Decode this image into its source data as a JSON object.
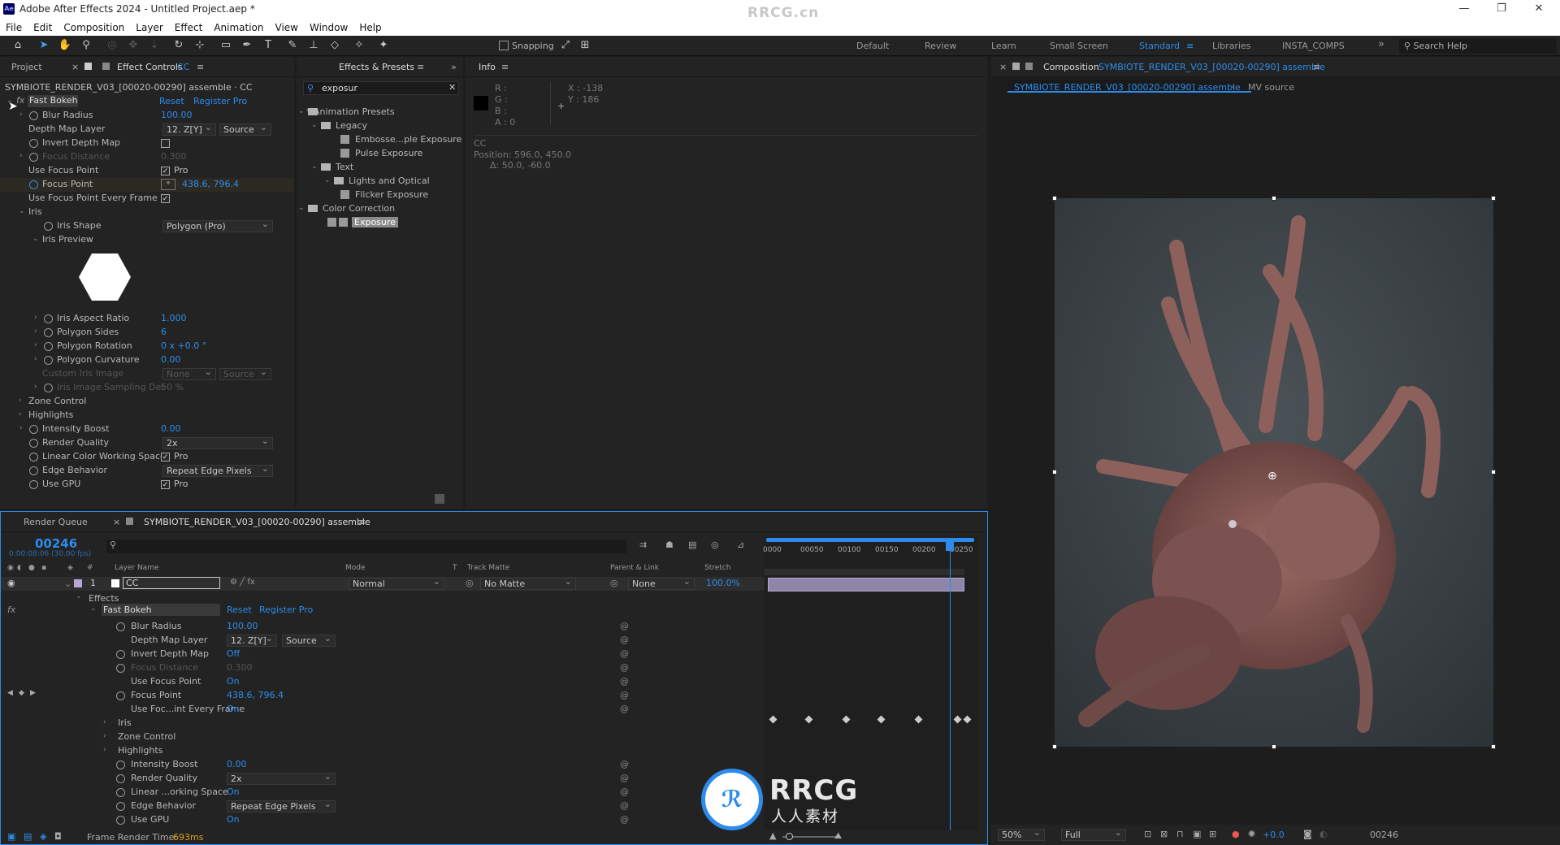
{
  "title": {
    "app_icon": "Ae",
    "text": "Adobe After Effects 2024 - Untitled Project.aep *",
    "watermark": "RRCG.cn"
  },
  "menu": [
    "File",
    "Edit",
    "Composition",
    "Layer",
    "Effect",
    "Animation",
    "View",
    "Window",
    "Help"
  ],
  "toolbar": {
    "snapping": "Snapping",
    "workspaces": [
      "Default",
      "Review",
      "Learn",
      "Small Screen",
      "Standard",
      "Libraries",
      "INSTA_COMPS"
    ],
    "active_workspace": "Standard",
    "search_help": "Search Help"
  },
  "effect_controls": {
    "tab_project": "Project",
    "tab_label": "Effect Controls",
    "tab_layer": "CC",
    "header": "SYMBIOTE_RENDER_V03_[00020-00290] assemble · CC",
    "effect_name": "Fast Bokeh",
    "reset": "Reset",
    "register": "Register Pro",
    "props": [
      {
        "label": "Blur Radius",
        "value": "100.00"
      },
      {
        "label": "Depth Map Layer",
        "value": "12. Z[Y]",
        "value2": "Source"
      },
      {
        "label": "Invert Depth Map",
        "value": ""
      },
      {
        "label": "Focus Distance",
        "value": "0.300"
      },
      {
        "label": "Use Focus Point",
        "value": "Pro"
      },
      {
        "label": "Focus Point",
        "value": "438.6, 796.4"
      },
      {
        "label": "Use Focus Point Every Frame",
        "value": ""
      },
      {
        "label": "Iris",
        "value": ""
      },
      {
        "label": "Iris Shape",
        "value": "Polygon (Pro)"
      },
      {
        "label": "Iris Preview",
        "value": ""
      },
      {
        "label": "Iris Aspect Ratio",
        "value": "1.000"
      },
      {
        "label": "Polygon Sides",
        "value": "6"
      },
      {
        "label": "Polygon Rotation",
        "value": "0 x +0.0 °"
      },
      {
        "label": "Polygon Curvature",
        "value": "0.00"
      },
      {
        "label": "Custom Iris Image",
        "value": "None",
        "value2": "Source"
      },
      {
        "label": "Iris Image Sampling Det",
        "value": "50 %"
      },
      {
        "label": "Zone Control",
        "value": ""
      },
      {
        "label": "Highlights",
        "value": ""
      },
      {
        "label": "Intensity Boost",
        "value": "0.00"
      },
      {
        "label": "Render Quality",
        "value": "2x"
      },
      {
        "label": "Linear Color Working Space",
        "value": "Pro"
      },
      {
        "label": "Edge Behavior",
        "value": "Repeat Edge Pixels"
      },
      {
        "label": "Use GPU",
        "value": "Pro"
      }
    ]
  },
  "effects_presets": {
    "tab": "Effects & Presets",
    "search": "exposur",
    "tree": [
      {
        "label": "* Animation Presets",
        "kind": "folder"
      },
      {
        "label": "Legacy",
        "kind": "folder"
      },
      {
        "label": "Embosse...ple Exposure",
        "kind": "preset"
      },
      {
        "label": "Pulse Exposure",
        "kind": "preset"
      },
      {
        "label": "Text",
        "kind": "folder"
      },
      {
        "label": "Lights and Optical",
        "kind": "folder"
      },
      {
        "label": "Flicker Exposure",
        "kind": "preset"
      },
      {
        "label": "Color Correction",
        "kind": "folder"
      },
      {
        "label": "Exposure",
        "kind": "effect"
      }
    ]
  },
  "info": {
    "tab": "Info",
    "r": "R :",
    "g": "G :",
    "b": "B :",
    "a": "A :  0",
    "x": "X : -138",
    "y": "Y : 186",
    "layer": "CC",
    "position": "Position: 596.0, 450.0",
    "delta": "Δ: 50.0, -60.0"
  },
  "composition": {
    "tab_prefix": "Composition",
    "tab_name": "SYMBIOTE_RENDER_V03_[00020-00290] assemble",
    "breadcrumb": "SYMBIOTE_RENDER_V03_[00020-00290] assemble",
    "breadcrumb2": "MV source",
    "zoom": "50%",
    "resolution": "Full",
    "exposure": "+0.0",
    "timecode": "00246"
  },
  "timeline": {
    "tab_render_queue": "Render Queue",
    "tab_comp": "SYMBIOTE_RENDER_V03_[00020-00290] assemble",
    "timecode": "00246",
    "fps": "0:00:08:06 (30.00 fps)",
    "col_layer": "Layer Name",
    "col_mode": "Mode",
    "col_t": "T",
    "col_matte": "Track Matte",
    "col_parent": "Parent & Link",
    "col_stretch": "Stretch",
    "layer": {
      "num": "1",
      "name": "CC",
      "mode": "Normal",
      "matte": "No Matte",
      "parent": "None",
      "stretch": "100.0%"
    },
    "effects": "Effects",
    "effect_name": "Fast Bokeh",
    "reset": "Reset",
    "register": "Register Pro",
    "rows": [
      {
        "label": "Blur Radius",
        "value": "100.00"
      },
      {
        "label": "Depth Map Layer",
        "value": "12. Z[Y]",
        "value2": "Source"
      },
      {
        "label": "Invert Depth Map",
        "value": "Off"
      },
      {
        "label": "Focus Distance",
        "value": "0.300"
      },
      {
        "label": "Use Focus Point",
        "value": "On"
      },
      {
        "label": "Focus Point",
        "value": "438.6, 796.4"
      },
      {
        "label": "Use Foc...int Every Frame",
        "value": "On"
      },
      {
        "label": "Iris",
        "value": ""
      },
      {
        "label": "Zone Control",
        "value": ""
      },
      {
        "label": "Highlights",
        "value": ""
      },
      {
        "label": "Intensity Boost",
        "value": "0.00"
      },
      {
        "label": "Render Quality",
        "value": "2x"
      },
      {
        "label": "Linear ...orking Space",
        "value": "On"
      },
      {
        "label": "Edge Behavior",
        "value": "Repeat Edge Pixels"
      },
      {
        "label": "Use GPU",
        "value": "On"
      }
    ],
    "ruler": [
      "0000",
      "00050",
      "00100",
      "00150",
      "00200",
      "00250"
    ],
    "frame_render_label": "Frame Render Time:",
    "frame_render_value": "693ms",
    "bottom_watermark": "RRCG",
    "bottom_watermark_cn": "人人素材"
  }
}
